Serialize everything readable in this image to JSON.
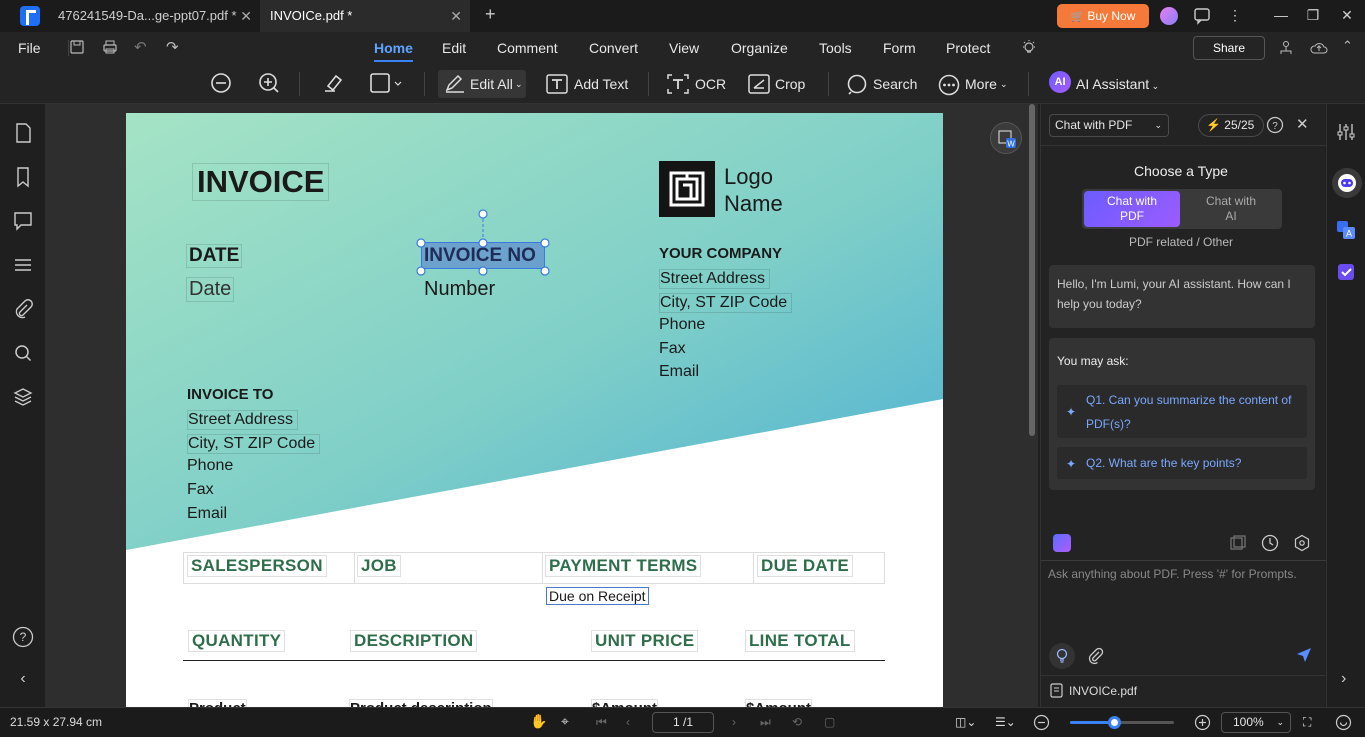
{
  "titlebar": {
    "tabs": [
      {
        "label": "476241549-Da...ge-ppt07.pdf *"
      },
      {
        "label": "INVOICe.pdf *"
      }
    ],
    "buy_now": "Buy Now"
  },
  "menubar": {
    "file": "File",
    "items": [
      "Home",
      "Edit",
      "Comment",
      "Convert",
      "View",
      "Organize",
      "Tools",
      "Form",
      "Protect"
    ],
    "active": "Home",
    "share": "Share"
  },
  "toolbar": {
    "edit_all": "Edit All",
    "add_text": "Add Text",
    "ocr": "OCR",
    "crop": "Crop",
    "search": "Search",
    "more": "More",
    "ai_badge": "AI",
    "ai_assistant": "AI Assistant"
  },
  "document": {
    "title": "INVOICE",
    "logo_line1": "Logo",
    "logo_line2": "Name",
    "date_label": "DATE",
    "date_value": "Date",
    "invoice_no_label": "INVOICE NO",
    "invoice_no_value": "Number",
    "company_label": "YOUR COMPANY",
    "company_lines": [
      "Street Address",
      "City, ST ZIP Code",
      "Phone",
      "Fax",
      "Email"
    ],
    "invoice_to_label": "INVOICE TO",
    "invoice_to_lines": [
      "Street Address",
      "City, ST ZIP Code",
      "Phone",
      "Fax",
      "Email"
    ],
    "table1_headers": [
      "SALESPERSON",
      "JOB",
      "PAYMENT TERMS",
      "DUE DATE"
    ],
    "payment_terms_value": "Due on Receipt",
    "table2_headers": [
      "QUANTITY",
      "DESCRIPTION",
      "UNIT PRICE",
      "LINE TOTAL"
    ],
    "row_partial": [
      "Product",
      "Product description",
      "$Amount",
      "$Amount"
    ]
  },
  "ai_panel": {
    "mode_select": "Chat with PDF",
    "credits": "25/25",
    "choose_type": "Choose a Type",
    "option_pdf_l1": "Chat with",
    "option_pdf_l2": "PDF",
    "option_ai_l1": "Chat with",
    "option_ai_l2": "AI",
    "option_caption": "PDF related / Other",
    "greeting": "Hello, I'm Lumi, your AI assistant. How can I help you today?",
    "you_may_ask": "You may ask:",
    "q1": "Q1. Can you summarize the content of PDF(s)?",
    "q2": "Q2. What are the key points?",
    "input_placeholder": "Ask anything about PDF. Press '#' for Prompts.",
    "attached_file": "INVOICe.pdf"
  },
  "statusbar": {
    "page_size": "21.59 x 27.94 cm",
    "page_indicator": "1 /1",
    "zoom": "100%",
    "zoom_fraction": 0.42
  },
  "colors": {
    "accent": "#3a82f6",
    "buy_now": "#f57a3a",
    "ai_gradient_start": "#6f5cff",
    "doc_green": "#2f6e4a",
    "doc_gradient_start": "#9fe0c4",
    "doc_gradient_end": "#5cb7d6"
  }
}
